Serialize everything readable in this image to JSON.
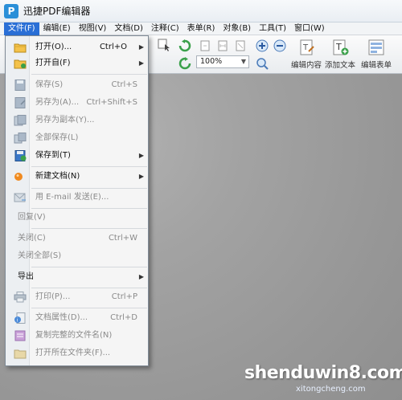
{
  "window": {
    "title": "迅捷PDF编辑器",
    "logo_letter": "P"
  },
  "menubar": {
    "items": [
      "文件(F)",
      "编辑(E)",
      "视图(V)",
      "文档(D)",
      "注释(C)",
      "表单(R)",
      "对象(B)",
      "工具(T)",
      "窗口(W)"
    ],
    "active_index": 0
  },
  "toolbar": {
    "zoom_value": "100%",
    "edit_content_label": "编辑内容",
    "add_text_label": "添加文本",
    "edit_form_label": "编辑表单"
  },
  "file_menu": {
    "open": {
      "label": "打开(O)...",
      "shortcut": "Ctrl+O"
    },
    "open_from": {
      "label": "打开自(F)"
    },
    "save": {
      "label": "保存(S)",
      "shortcut": "Ctrl+S"
    },
    "save_as": {
      "label": "另存为(A)...",
      "shortcut": "Ctrl+Shift+S"
    },
    "save_copy": {
      "label": "另存为副本(Y)..."
    },
    "save_all": {
      "label": "全部保存(L)"
    },
    "save_to": {
      "label": "保存到(T)"
    },
    "new_document": {
      "label": "新建文档(N)"
    },
    "email": {
      "label": "用 E-mail 发送(E)..."
    },
    "revert": {
      "label": "回复(V)"
    },
    "close": {
      "label": "关闭(C)",
      "shortcut": "Ctrl+W"
    },
    "close_all": {
      "label": "关闭全部(S)"
    },
    "export": {
      "label": "导出"
    },
    "print": {
      "label": "打印(P)...",
      "shortcut": "Ctrl+P"
    },
    "doc_properties": {
      "label": "文档属性(D)...",
      "shortcut": "Ctrl+D"
    },
    "copy_full_name": {
      "label": "复制完整的文件名(N)"
    },
    "open_folder": {
      "label": "打开所在文件夹(F)..."
    }
  },
  "watermark": {
    "main": "shenduwin8.com",
    "sub": "xitongcheng.com"
  },
  "colors": {
    "accent": "#2a6fd6",
    "highlight": "#ffe49a"
  }
}
